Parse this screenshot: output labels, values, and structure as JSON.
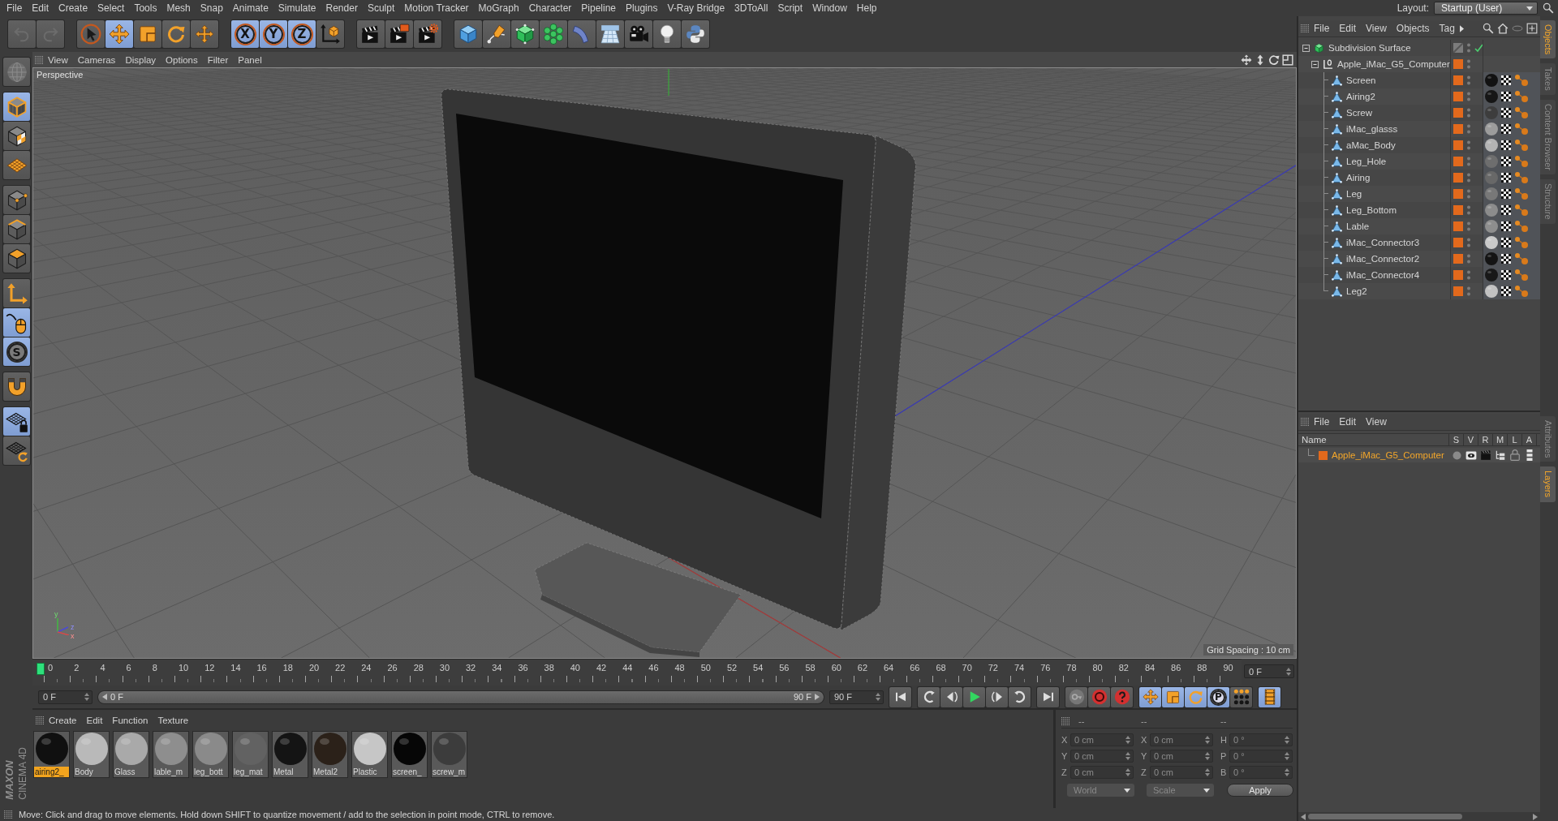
{
  "menu_bar": [
    "File",
    "Edit",
    "Create",
    "Select",
    "Tools",
    "Mesh",
    "Snap",
    "Animate",
    "Simulate",
    "Render",
    "Sculpt",
    "Motion Tracker",
    "MoGraph",
    "Character",
    "Pipeline",
    "Plugins",
    "V-Ray Bridge",
    "3DToAll",
    "Script",
    "Window",
    "Help"
  ],
  "layout": {
    "label": "Layout:",
    "value": "Startup (User)"
  },
  "toolbar": {
    "history": [
      {
        "disabled": true
      },
      {
        "disabled": true
      }
    ],
    "groups": [
      [
        {
          "selected": false
        },
        {
          "selected": true
        },
        {
          "selected": false
        },
        {
          "selected": false
        },
        {
          "selected": false
        }
      ],
      [
        {
          "label": "X",
          "selected": true
        },
        {
          "label": "Y",
          "selected": true
        },
        {
          "label": "Z",
          "selected": true
        },
        {
          "selected": false
        }
      ],
      [
        {
          "selected": false
        },
        {
          "selected": false
        },
        {
          "selected": false
        }
      ],
      [
        {
          "selected": false
        },
        {
          "selected": false
        },
        {
          "selected": false
        },
        {
          "selected": false
        },
        {
          "selected": false
        },
        {
          "selected": false
        },
        {
          "selected": false
        },
        {
          "selected": false
        },
        {
          "selected": false
        }
      ]
    ]
  },
  "tool_strip": {
    "groups": [
      [
        {
          "selected": false,
          "disabled": true
        }
      ],
      [
        {
          "selected": true
        },
        {
          "selected": false
        },
        {
          "selected": false
        }
      ],
      [
        {
          "selected": false
        },
        {
          "selected": false
        },
        {
          "selected": false
        }
      ],
      [
        {
          "selected": false
        },
        {
          "selected": true
        },
        {
          "label": "S",
          "selected": true
        }
      ],
      [
        {
          "selected": false
        }
      ],
      [
        {
          "selected": true
        },
        {
          "selected": false
        }
      ]
    ]
  },
  "logo": {
    "brand": "MAXON",
    "product": "CINEMA 4D"
  },
  "viewport": {
    "menu": [
      "View",
      "Cameras",
      "Display",
      "Options",
      "Filter",
      "Panel"
    ],
    "camera": "Perspective",
    "axis_labels": [
      "y",
      "z",
      "x"
    ],
    "grid_spacing": "Grid Spacing : 10 cm"
  },
  "timeline": {
    "frame_labels": [
      "0",
      "2",
      "4",
      "6",
      "8",
      "10",
      "12",
      "14",
      "16",
      "18",
      "20",
      "22",
      "24",
      "26",
      "28",
      "30",
      "32",
      "34",
      "36",
      "38",
      "40",
      "42",
      "44",
      "46",
      "48",
      "50",
      "52",
      "54",
      "56",
      "58",
      "60",
      "62",
      "64",
      "66",
      "68",
      "70",
      "72",
      "74",
      "76",
      "78",
      "80",
      "82",
      "84",
      "86",
      "88",
      "90"
    ],
    "playhead": {
      "level": 0
    },
    "current_frame": "0 F"
  },
  "transport": {
    "start": "0 F",
    "range": {
      "start": "0 F",
      "end": "90 F",
      "level": 1
    },
    "end": "90 F",
    "key_tracks": [
      {
        "selected": true
      },
      {
        "selected": true
      },
      {
        "selected": true
      },
      {
        "label": "P",
        "selected": true
      },
      {
        "selected": false
      }
    ],
    "timeline_button": {
      "selected": true
    }
  },
  "material_manager": {
    "menu": [
      "Create",
      "Edit",
      "Function",
      "Texture"
    ],
    "materials": [
      {
        "name": "airing2_",
        "color": "#101010",
        "selected": true
      },
      {
        "name": "Body",
        "color": "#b9b9b9",
        "selected": false
      },
      {
        "name": "Glass",
        "color": "#a9a9a9",
        "selected": false
      },
      {
        "name": "lable_m",
        "color": "#8e8e8e",
        "selected": false
      },
      {
        "name": "leg_bott",
        "color": "#8a8a8a",
        "selected": false
      },
      {
        "name": "leg_mat",
        "color": "#626262",
        "selected": false
      },
      {
        "name": "Metal",
        "color": "#141414",
        "selected": false
      },
      {
        "name": "Metal2",
        "color": "#2b2119",
        "selected": false
      },
      {
        "name": "Plastic",
        "color": "#c6c6c6",
        "selected": false
      },
      {
        "name": "screen_",
        "color": "#060606",
        "selected": false
      },
      {
        "name": "screw_m",
        "color": "#3c3c3c",
        "selected": false
      }
    ]
  },
  "coordinates": {
    "disabled": true,
    "headers": [
      "--",
      "--",
      "--"
    ],
    "columns": [
      [
        {
          "label": "X",
          "value": "0 cm"
        },
        {
          "label": "Y",
          "value": "0 cm"
        },
        {
          "label": "Z",
          "value": "0 cm"
        }
      ],
      [
        {
          "label": "X",
          "value": "0 cm"
        },
        {
          "label": "Y",
          "value": "0 cm"
        },
        {
          "label": "Z",
          "value": "0 cm"
        }
      ],
      [
        {
          "label": "H",
          "value": "0 °"
        },
        {
          "label": "P",
          "value": "0 °"
        },
        {
          "label": "B",
          "value": "0 °"
        }
      ]
    ],
    "dropdowns": [
      "World",
      "Scale"
    ],
    "apply": "Apply"
  },
  "status_bar": "Move: Click and drag to move elements. Hold down SHIFT to quantize movement / add to the selection in point mode, CTRL to remove.",
  "object_manager": {
    "menu": [
      "File",
      "Edit",
      "View",
      "Objects",
      "Tag"
    ],
    "objects": [
      {
        "name": "Subdivision Surface",
        "kind": "subdivision",
        "expanded": true,
        "in_layer": false,
        "enabled": true,
        "children": [
          {
            "name": "Apple_iMac_G5_Computer",
            "kind": "null",
            "expanded": true,
            "in_layer": true,
            "children": [
              {
                "name": "Screen",
                "kind": "polygon",
                "in_layer": true,
                "color": "#121212"
              },
              {
                "name": "Airing2",
                "kind": "polygon",
                "in_layer": true,
                "color": "#161616"
              },
              {
                "name": "Screw",
                "kind": "polygon",
                "in_layer": true,
                "color": "#3d3d3d"
              },
              {
                "name": "iMac_glasss",
                "kind": "polygon",
                "in_layer": true,
                "color": "#9c9c9c"
              },
              {
                "name": "aMac_Body",
                "kind": "polygon",
                "in_layer": true,
                "color": "#b4b4b4"
              },
              {
                "name": "Leg_Hole",
                "kind": "polygon",
                "in_layer": true,
                "color": "#6e6e6e"
              },
              {
                "name": "Airing",
                "kind": "polygon",
                "in_layer": true,
                "color": "#686868"
              },
              {
                "name": "Leg",
                "kind": "polygon",
                "in_layer": true,
                "color": "#787878"
              },
              {
                "name": "Leg_Bottom",
                "kind": "polygon",
                "in_layer": true,
                "color": "#8c8c8c"
              },
              {
                "name": "Lable",
                "kind": "polygon",
                "in_layer": true,
                "color": "#8e8e8e"
              },
              {
                "name": "iMac_Connector3",
                "kind": "polygon",
                "in_layer": true,
                "color": "#cacaca"
              },
              {
                "name": "iMac_Connector2",
                "kind": "polygon",
                "in_layer": true,
                "color": "#141414"
              },
              {
                "name": "iMac_Connector4",
                "kind": "polygon",
                "in_layer": true,
                "color": "#181818"
              },
              {
                "name": "Leg2",
                "kind": "polygon",
                "in_layer": true,
                "color": "#c2c2c2"
              }
            ]
          }
        ]
      }
    ]
  },
  "layer_manager": {
    "menu": [
      "File",
      "Edit",
      "View"
    ],
    "columns": [
      "Name",
      "S",
      "V",
      "R",
      "M",
      "L",
      "A"
    ],
    "layers": [
      {
        "name": "Apple_iMac_G5_Computer",
        "color": "#e2691c",
        "selected": true
      }
    ]
  },
  "side_tabs": {
    "upper": [
      {
        "label": "Objects",
        "selected": true
      },
      {
        "label": "Takes",
        "selected": false
      },
      {
        "label": "Content Browser",
        "selected": false
      },
      {
        "label": "Structure",
        "selected": false
      }
    ],
    "lower": [
      {
        "label": "Attributes",
        "selected": false
      },
      {
        "label": "Layers",
        "selected": true
      }
    ]
  }
}
